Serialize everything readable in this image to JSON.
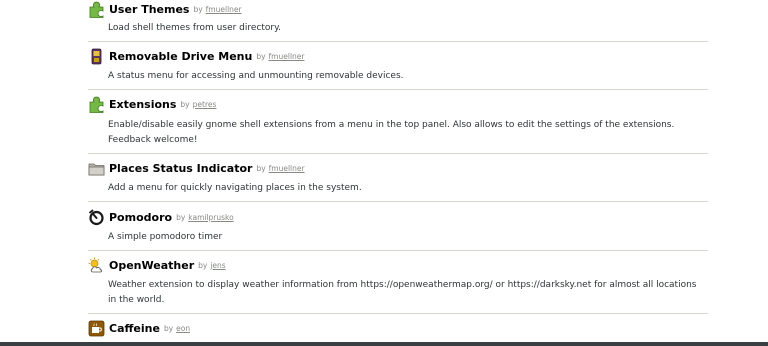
{
  "extensions": [
    {
      "name": "User Themes",
      "by": "by",
      "author": "fmuellner",
      "description": "Load shell themes from user directory.",
      "icon": "puzzle-piece-icon"
    },
    {
      "name": "Removable Drive Menu",
      "by": "by",
      "author": "fmuellner",
      "description": "A status menu for accessing and unmounting removable devices.",
      "icon": "usb-drive-icon"
    },
    {
      "name": "Extensions",
      "by": "by",
      "author": "petres",
      "description": "Enable/disable easily gnome shell extensions from a menu in the top panel. Also allows to edit the settings of the extensions. Feedback welcome!",
      "icon": "puzzle-piece-icon"
    },
    {
      "name": "Places Status Indicator",
      "by": "by",
      "author": "fmuellner",
      "description": "Add a menu for quickly navigating places in the system.",
      "icon": "folder-icon"
    },
    {
      "name": "Pomodoro",
      "by": "by",
      "author": "kamilprusko",
      "description": "A simple pomodoro timer",
      "icon": "timer-icon"
    },
    {
      "name": "OpenWeather",
      "by": "by",
      "author": "jens",
      "description": "Weather extension to display weather information from https://openweathermap.org/ or https://darksky.net for almost all locations in the world.",
      "icon": "weather-icon"
    },
    {
      "name": "Caffeine",
      "by": "by",
      "author": "eon",
      "description": "",
      "icon": "coffee-cup-icon"
    }
  ],
  "colors": {
    "puzzle": "#73b944",
    "separator": "#d3d7cf",
    "author": "#888a85"
  }
}
